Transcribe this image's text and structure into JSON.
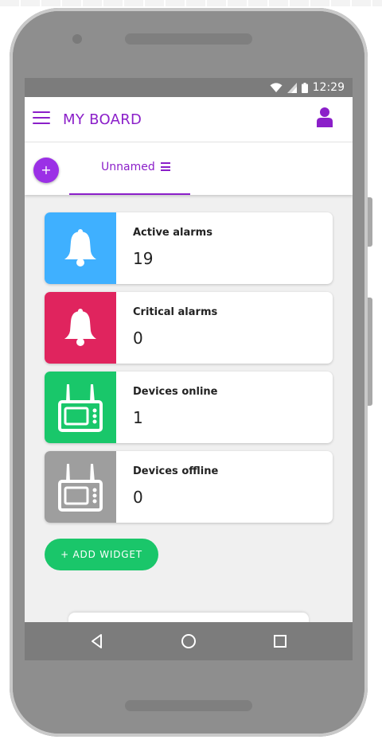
{
  "status_bar": {
    "time": "12:29",
    "icons": [
      "wifi-icon",
      "signal-icon",
      "battery-icon"
    ]
  },
  "app_bar": {
    "title": "MY BOARD",
    "menu_icon": "hamburger-icon",
    "user_icon": "user-icon"
  },
  "tabs": {
    "add_label": "+",
    "items": [
      {
        "label": "Unnamed",
        "icon": "tab-menu-icon"
      }
    ]
  },
  "widgets": [
    {
      "label": "Active alarms",
      "value": "19",
      "icon": "bell-icon",
      "color": "#3fb0ff"
    },
    {
      "label": "Critical alarms",
      "value": "0",
      "icon": "bell-icon",
      "color": "#e0245e"
    },
    {
      "label": "Devices online",
      "value": "1",
      "icon": "router-icon",
      "color": "#19c76a"
    },
    {
      "label": "Devices offline",
      "value": "0",
      "icon": "router-icon",
      "color": "#9e9e9e"
    }
  ],
  "add_widget_label": "+ ADD WIDGET",
  "nav_bar": {
    "icons": [
      "back-icon",
      "home-icon",
      "recents-icon"
    ]
  },
  "colors": {
    "accent": "#8b1fc9",
    "add_button": "#1ac66a"
  }
}
